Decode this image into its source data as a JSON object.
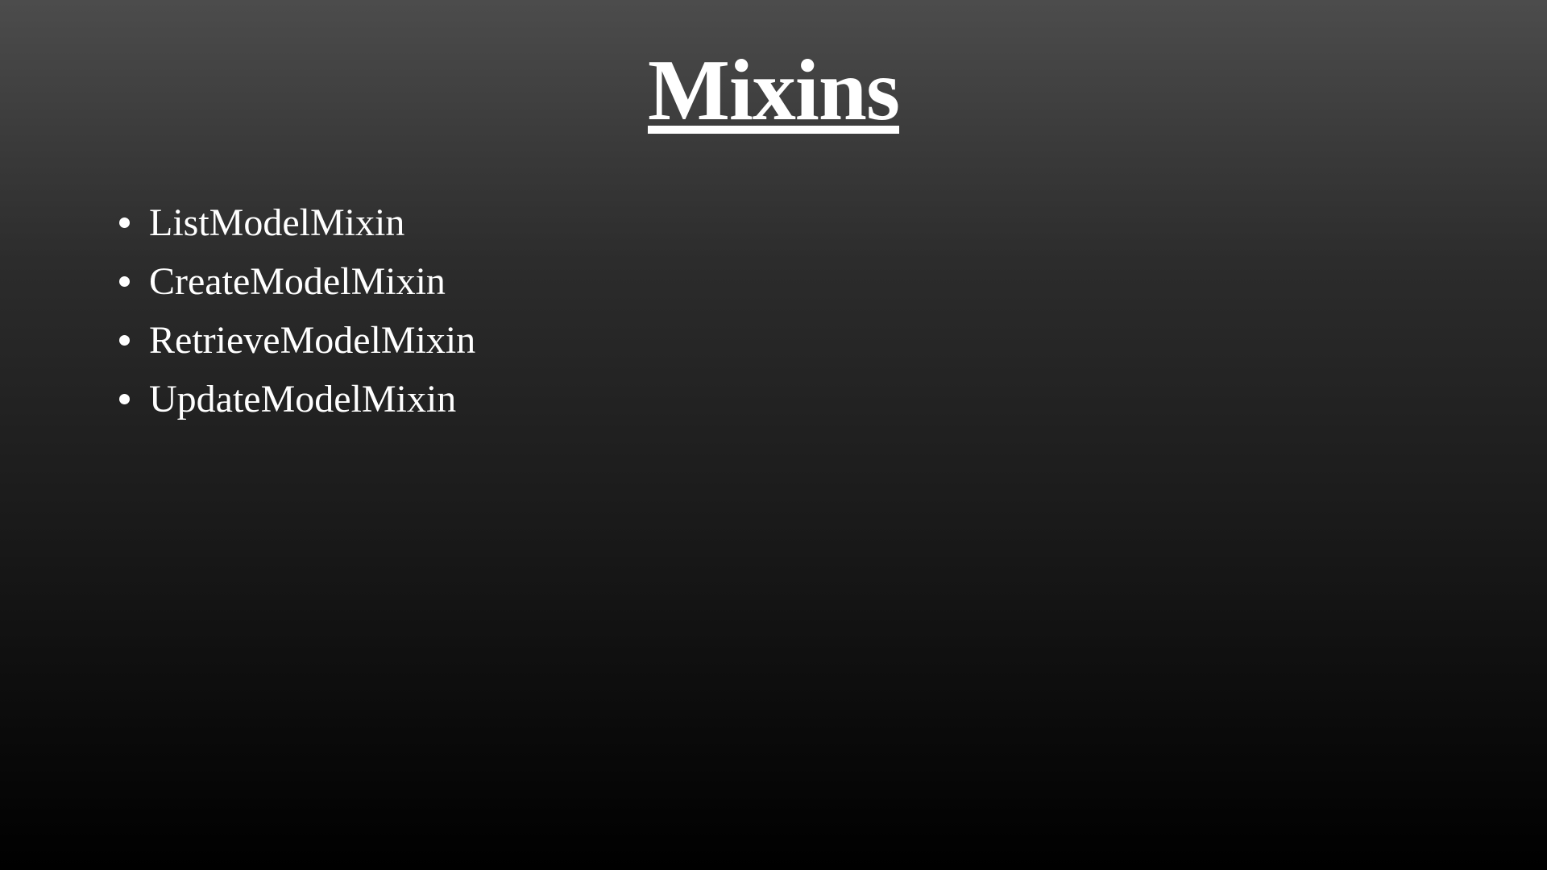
{
  "slide": {
    "title": "Mixins",
    "bullets": [
      "ListModelMixin",
      "CreateModelMixin",
      "RetrieveModelMixin",
      "UpdateModelMixin"
    ]
  },
  "colors": {
    "text": "#ffffff",
    "background_top": "#4c4c4c",
    "background_bottom": "#000000"
  }
}
